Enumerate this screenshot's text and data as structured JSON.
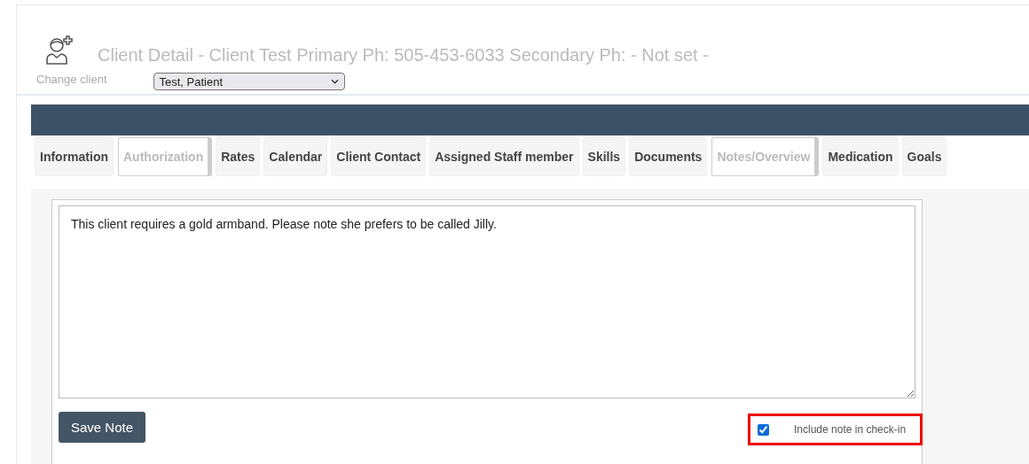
{
  "header": {
    "title": "Client Detail - Client Test Primary Ph: 505-453-6033 Secondary Ph: - Not set -",
    "change_client_label": "Change client",
    "client_select": {
      "value": "Test, Patient"
    }
  },
  "tabs": [
    {
      "label": "Information",
      "selected": false
    },
    {
      "label": "Authorization",
      "selected": true
    },
    {
      "label": "Rates",
      "selected": false
    },
    {
      "label": "Calendar",
      "selected": false
    },
    {
      "label": "Client Contact",
      "selected": false
    },
    {
      "label": "Assigned Staff member",
      "selected": false
    },
    {
      "label": "Skills",
      "selected": false
    },
    {
      "label": "Documents",
      "selected": false
    },
    {
      "label": "Notes/Overview",
      "selected": true
    },
    {
      "label": "Medication",
      "selected": false
    },
    {
      "label": "Goals",
      "selected": false
    }
  ],
  "note": {
    "value": "This client requires a gold armband. Please note she prefers to be called Jilly."
  },
  "save_button": "Save Note",
  "include_checkbox": {
    "label": "Include note in check-in",
    "checked": true,
    "highlighted": true
  }
}
